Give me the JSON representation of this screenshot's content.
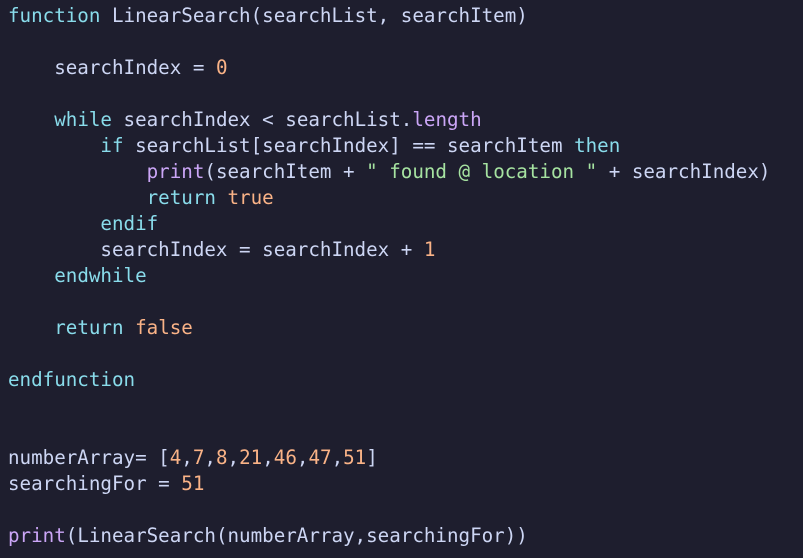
{
  "theme": {
    "background": "#1e1e2e",
    "colors": {
      "plain": "#cdd6f4",
      "keyword": "#89dceb",
      "number": "#fab387",
      "string": "#a6e3a1",
      "builtin": "#cba6f7",
      "property": "#cba6f7"
    }
  },
  "lines": [
    [
      {
        "t": "function",
        "c": "keyword"
      },
      {
        "t": " LinearSearch(searchList, searchItem)",
        "c": "plain"
      }
    ],
    [],
    [
      {
        "t": "    searchIndex = ",
        "c": "plain"
      },
      {
        "t": "0",
        "c": "number"
      }
    ],
    [],
    [
      {
        "t": "    ",
        "c": "plain"
      },
      {
        "t": "while",
        "c": "keyword"
      },
      {
        "t": " searchIndex < searchList.",
        "c": "plain"
      },
      {
        "t": "length",
        "c": "property"
      }
    ],
    [
      {
        "t": "        ",
        "c": "plain"
      },
      {
        "t": "if",
        "c": "keyword"
      },
      {
        "t": " searchList[searchIndex] == searchItem ",
        "c": "plain"
      },
      {
        "t": "then",
        "c": "keyword"
      }
    ],
    [
      {
        "t": "            ",
        "c": "plain"
      },
      {
        "t": "print",
        "c": "builtin"
      },
      {
        "t": "(searchItem + ",
        "c": "plain"
      },
      {
        "t": "\" found @ location \"",
        "c": "string"
      },
      {
        "t": " + searchIndex)",
        "c": "plain"
      }
    ],
    [
      {
        "t": "            ",
        "c": "plain"
      },
      {
        "t": "return",
        "c": "keyword"
      },
      {
        "t": " ",
        "c": "plain"
      },
      {
        "t": "true",
        "c": "number"
      }
    ],
    [
      {
        "t": "        ",
        "c": "plain"
      },
      {
        "t": "endif",
        "c": "keyword"
      }
    ],
    [
      {
        "t": "        searchIndex = searchIndex + ",
        "c": "plain"
      },
      {
        "t": "1",
        "c": "number"
      }
    ],
    [
      {
        "t": "    ",
        "c": "plain"
      },
      {
        "t": "endwhile",
        "c": "keyword"
      }
    ],
    [],
    [
      {
        "t": "    ",
        "c": "plain"
      },
      {
        "t": "return",
        "c": "keyword"
      },
      {
        "t": " ",
        "c": "plain"
      },
      {
        "t": "false",
        "c": "number"
      }
    ],
    [],
    [
      {
        "t": "endfunction",
        "c": "keyword"
      }
    ],
    [],
    [],
    [
      {
        "t": "numberArray= [",
        "c": "plain"
      },
      {
        "t": "4",
        "c": "number"
      },
      {
        "t": ",",
        "c": "plain"
      },
      {
        "t": "7",
        "c": "number"
      },
      {
        "t": ",",
        "c": "plain"
      },
      {
        "t": "8",
        "c": "number"
      },
      {
        "t": ",",
        "c": "plain"
      },
      {
        "t": "21",
        "c": "number"
      },
      {
        "t": ",",
        "c": "plain"
      },
      {
        "t": "46",
        "c": "number"
      },
      {
        "t": ",",
        "c": "plain"
      },
      {
        "t": "47",
        "c": "number"
      },
      {
        "t": ",",
        "c": "plain"
      },
      {
        "t": "51",
        "c": "number"
      },
      {
        "t": "]",
        "c": "plain"
      }
    ],
    [
      {
        "t": "searchingFor = ",
        "c": "plain"
      },
      {
        "t": "51",
        "c": "number"
      }
    ],
    [],
    [
      {
        "t": "print",
        "c": "builtin"
      },
      {
        "t": "(LinearSearch(numberArray,searchingFor))",
        "c": "plain"
      }
    ]
  ]
}
